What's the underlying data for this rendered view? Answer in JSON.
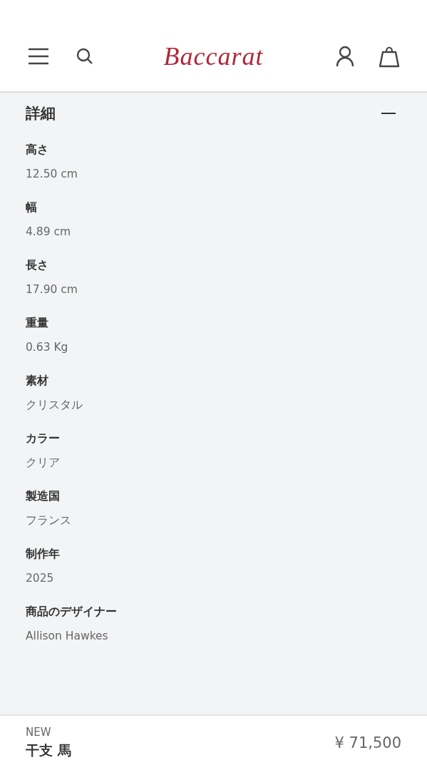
{
  "header": {
    "logo": "Baccarat"
  },
  "details": {
    "title": "詳細",
    "expanded": true,
    "specs": [
      {
        "label": "高さ",
        "value": "12.50 cm"
      },
      {
        "label": "幅",
        "value": "4.89 cm"
      },
      {
        "label": "長さ",
        "value": "17.90 cm"
      },
      {
        "label": "重量",
        "value": "0.63 Kg"
      },
      {
        "label": "素材",
        "value": "クリスタル"
      },
      {
        "label": "カラー",
        "value": "クリア"
      },
      {
        "label": "製造国",
        "value": "フランス"
      },
      {
        "label": "制作年",
        "value": "2025"
      },
      {
        "label": "商品のデザイナー",
        "value": "Allison Hawkes"
      }
    ]
  },
  "product_bar": {
    "badge": "NEW",
    "name": "干支 馬",
    "price": "¥ 71,500"
  }
}
